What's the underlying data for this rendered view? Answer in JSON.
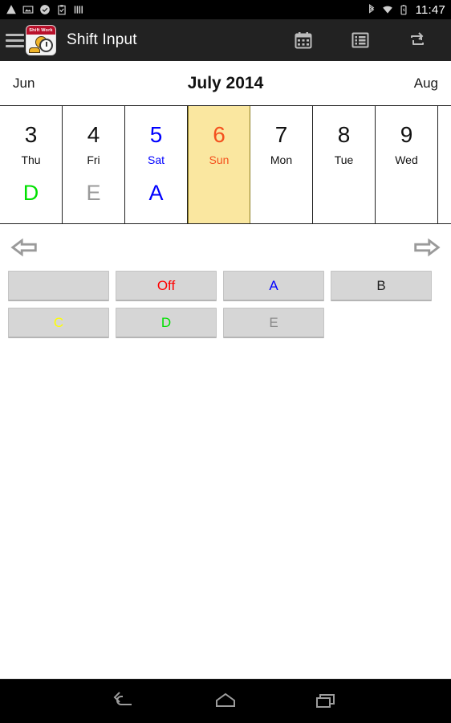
{
  "status_bar": {
    "icons": [
      "warning-icon",
      "image-icon",
      "check-circle-icon",
      "clipboard-check-icon",
      "bars-icon"
    ],
    "right_icons": [
      "bluetooth-icon",
      "wifi-icon",
      "battery-icon"
    ],
    "time": "11:47"
  },
  "action_bar": {
    "menu_icon": "hamburger-menu-icon",
    "app_icon_banner": "Shift Work",
    "title": "Shift Input",
    "actions": [
      {
        "name": "calendar-view-button",
        "icon": "calendar-icon"
      },
      {
        "name": "list-view-button",
        "icon": "list-icon"
      },
      {
        "name": "repeat-pattern-button",
        "icon": "repeat-icon"
      }
    ]
  },
  "month_bar": {
    "prev_month": "Jun",
    "title": "July 2014",
    "next_month": "Aug"
  },
  "week_strip": {
    "days": [
      {
        "num": "3",
        "name": "Thu",
        "shift": "D",
        "num_color": "#111111",
        "name_color": "#111111",
        "shift_color": "#00e000",
        "selected": false
      },
      {
        "num": "4",
        "name": "Fri",
        "shift": "E",
        "num_color": "#111111",
        "name_color": "#111111",
        "shift_color": "#9a9a9a",
        "selected": false
      },
      {
        "num": "5",
        "name": "Sat",
        "shift": "A",
        "num_color": "#0000ff",
        "name_color": "#0000ff",
        "shift_color": "#0000ff",
        "selected": false
      },
      {
        "num": "6",
        "name": "Sun",
        "shift": "",
        "num_color": "#f4511e",
        "name_color": "#f4511e",
        "shift_color": "#f4511e",
        "selected": true
      },
      {
        "num": "7",
        "name": "Mon",
        "shift": "",
        "num_color": "#111111",
        "name_color": "#111111",
        "shift_color": "#111111",
        "selected": false
      },
      {
        "num": "8",
        "name": "Tue",
        "shift": "",
        "num_color": "#111111",
        "name_color": "#111111",
        "shift_color": "#111111",
        "selected": false
      },
      {
        "num": "9",
        "name": "Wed",
        "shift": "",
        "num_color": "#111111",
        "name_color": "#111111",
        "shift_color": "#111111",
        "selected": false
      },
      {
        "num": "",
        "name": "",
        "shift": "",
        "num_color": "#111111",
        "name_color": "#111111",
        "shift_color": "#111111",
        "selected": false
      }
    ]
  },
  "week_nav": {
    "prev_icon": "arrow-left-icon",
    "next_icon": "arrow-right-icon"
  },
  "shift_buttons": {
    "row1": [
      {
        "label": "",
        "color": "#222222"
      },
      {
        "label": "Off",
        "color": "#ff0000"
      },
      {
        "label": "A",
        "color": "#0000ff"
      },
      {
        "label": "B",
        "color": "#222222"
      }
    ],
    "row2": [
      {
        "label": "C",
        "color": "#ffff00"
      },
      {
        "label": "D",
        "color": "#00e000"
      },
      {
        "label": "E",
        "color": "#8a8a8a"
      }
    ]
  },
  "nav_bar": {
    "back": "back-icon",
    "home": "home-icon",
    "recents": "recent-apps-icon"
  }
}
